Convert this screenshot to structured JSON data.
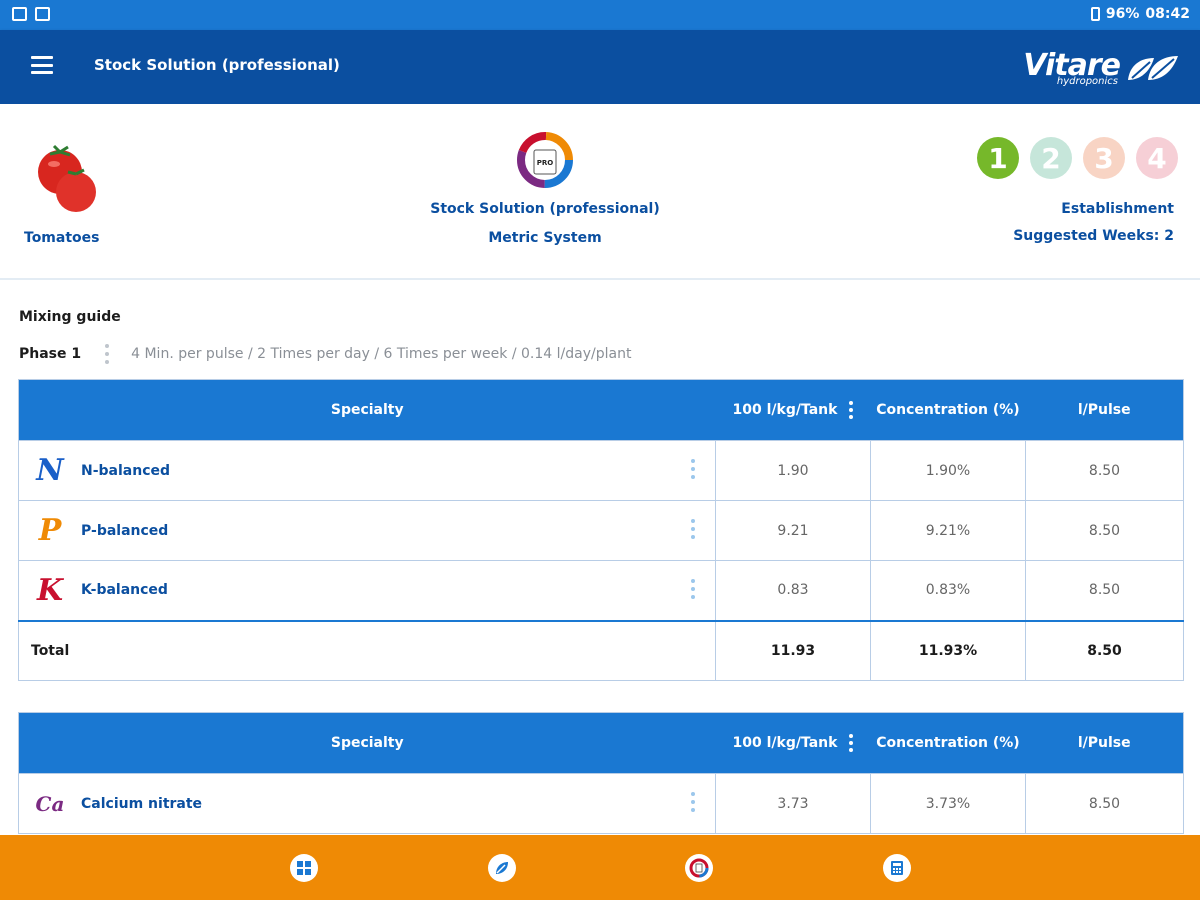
{
  "status_bar": {
    "battery": "96%",
    "time": "08:42"
  },
  "app_bar": {
    "title": "Stock Solution (professional)",
    "brand_name": "Vitare",
    "brand_sub": "hydroponics"
  },
  "header": {
    "crop_label": "Tomatoes",
    "mode_icon_text": "PRO",
    "mode_line1": "Stock Solution (professional)",
    "mode_line2": "Metric System",
    "phases": [
      {
        "label": "1",
        "color": "#76b82a"
      },
      {
        "label": "2",
        "color": "#c6e6da"
      },
      {
        "label": "3",
        "color": "#f8d4c4"
      },
      {
        "label": "4",
        "color": "#f6cfd6"
      }
    ],
    "stage_name": "Establishment",
    "suggested_weeks": "Suggested Weeks: 2"
  },
  "mixing": {
    "title": "Mixing guide",
    "phase_label": "Phase 1",
    "phase_desc": "4 Min. per pulse / 2 Times per day / 6  Times per week / 0.14 l/day/plant"
  },
  "table1": {
    "headers": [
      "Specialty",
      "100 l/kg/Tank",
      "Concentration (%)",
      "l/Pulse"
    ],
    "rows": [
      {
        "name": "N-balanced",
        "letter": "N",
        "color": "#1a5fc8",
        "tank": "1.90",
        "conc": "1.90%",
        "pulse": "8.50"
      },
      {
        "name": "P-balanced",
        "letter": "P",
        "color": "#ef8a05",
        "tank": "9.21",
        "conc": "9.21%",
        "pulse": "8.50"
      },
      {
        "name": "K-balanced",
        "letter": "K",
        "color": "#c8102e",
        "tank": "0.83",
        "conc": "0.83%",
        "pulse": "8.50"
      }
    ],
    "total": {
      "label": "Total",
      "tank": "11.93",
      "conc": "11.93%",
      "pulse": "8.50"
    }
  },
  "table2": {
    "headers": [
      "Specialty",
      "100 l/kg/Tank",
      "Concentration (%)",
      "l/Pulse"
    ],
    "rows": [
      {
        "name": "Calcium nitrate",
        "letter": "Ca",
        "color": "#7b2a82",
        "tank": "3.73",
        "conc": "3.73%",
        "pulse": "8.50"
      }
    ]
  },
  "bottom_nav": [
    "dashboard-icon",
    "leaf-icon",
    "mode-icon",
    "calculator-icon"
  ]
}
